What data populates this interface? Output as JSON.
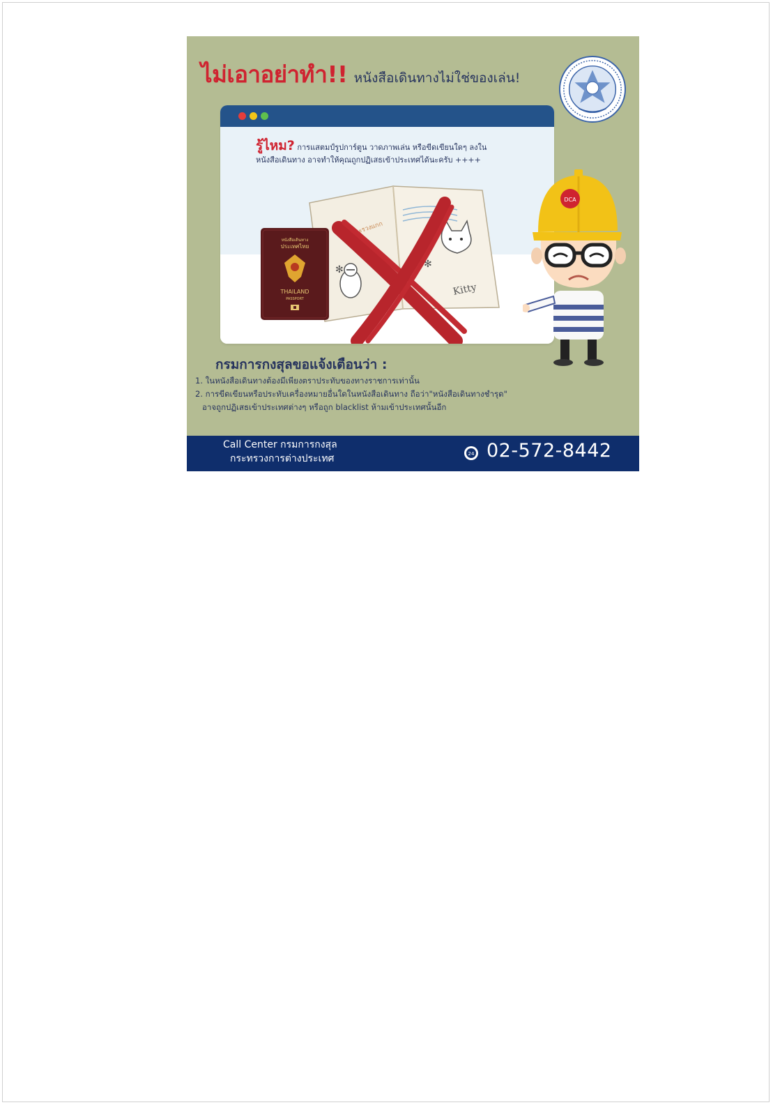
{
  "poster": {
    "headline_big": "ไม่เอาอย่าทำ!!",
    "headline_small": "หนังสือเดินทางไม่ใช่ของเล่น!",
    "question_label": "รู้ไหม?",
    "question_line1": " การแสตมป์รูปการ์ตูน วาดภาพเล่น หรือขีดเขียนใดๆ ลงใน",
    "question_line2": "หนังสือเดินทาง อาจทำให้คุณถูกปฏิเสธเข้าประเทศได้นะครับ ++++",
    "passport": {
      "top_small": "หนังสือเดินทาง",
      "top_country": "ประเทศไทย",
      "country_en": "THAILAND",
      "doc_en": "PASSPORT"
    },
    "stamp_text": "ขวยมะรวงแกก",
    "kitty_text": "Kitty",
    "helmet_badge": "DCA",
    "warning_title": "กรมการกงสุลขอแจ้งเตือนว่า :",
    "warnings": [
      "1. ในหนังสือเดินทางต้องมีเพียงตราประทับของทางราชการเท่านั้น",
      "2. การขีดเขียนหรือประทับเครื่องหมายอื่นใดในหนังสือเดินทาง ถือว่า\"หนังสือเดินทางชำรุด\"",
      "อาจถูกปฏิเสธเข้าประเทศต่างๆ หรือถูก blacklist ห้ามเข้าประเทศนั้นอีก"
    ],
    "footer": {
      "callcenter_line1": "Call Center กรมการกงสุล",
      "callcenter_line2": "กระทรวงการต่างประเทศ",
      "phone_icon_label": "24",
      "phone": "02-572-8442"
    }
  },
  "colors": {
    "background": "#b4bc93",
    "accent_red": "#cf2330",
    "navy": "#27345e",
    "footer_blue": "#0f2e6c",
    "window_bar": "#24538a"
  }
}
